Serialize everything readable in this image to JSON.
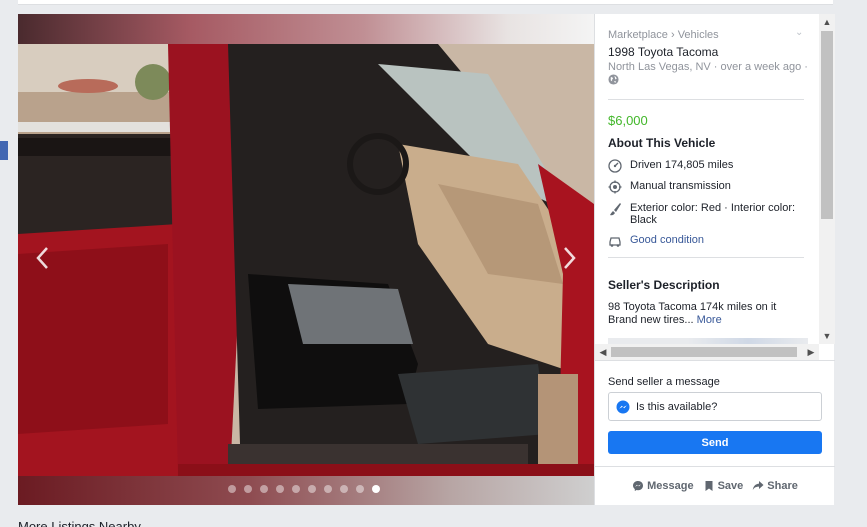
{
  "page": {
    "more_listings_heading": "More Listings Nearby"
  },
  "listing": {
    "breadcrumb": "Marketplace › Vehicles",
    "title": "1998 Toyota Tacoma",
    "location_line": "North Las Vegas, NV · over a week ago ·",
    "price": "$6,000",
    "about_heading": "About This Vehicle",
    "specs": [
      {
        "icon": "speedometer-icon",
        "text": "Driven 174,805 miles"
      },
      {
        "icon": "transmission-icon",
        "text": "Manual transmission"
      },
      {
        "icon": "paint-brush-icon",
        "text": "Exterior color: Red · Interior color: Black"
      },
      {
        "icon": "car-icon",
        "text": "Good condition"
      }
    ],
    "description_heading": "Seller's Description",
    "description": "98 Toyota Tacoma 174k miles on it Brand new tires...",
    "more_link": "More"
  },
  "photo": {
    "dot_count": 10,
    "active_dot": 9,
    "icons": [
      "chevron-left-icon",
      "chevron-right-icon"
    ]
  },
  "message": {
    "label": "Send seller a message",
    "input_value": "Is this available?",
    "send_label": "Send"
  },
  "actions": {
    "message_label": "Message",
    "save_label": "Save",
    "share_label": "Share"
  },
  "colors": {
    "price": "#42b72a",
    "send_button": "#1877f2",
    "link": "#385898"
  }
}
